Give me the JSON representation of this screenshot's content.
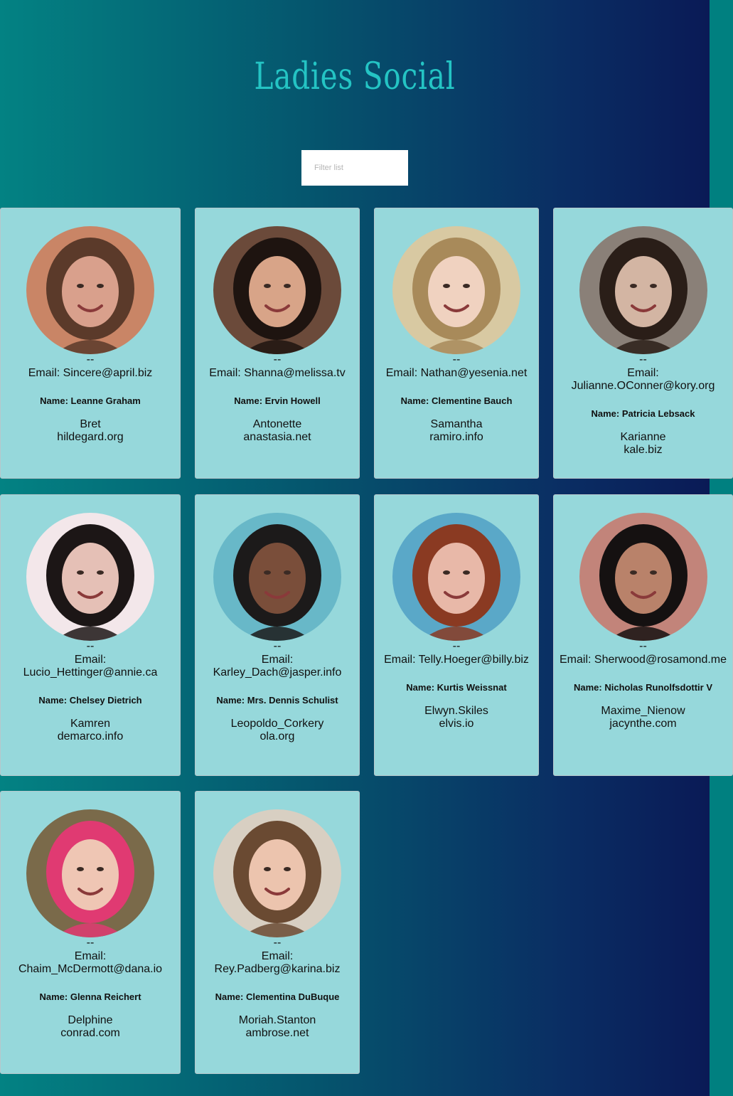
{
  "app": {
    "title": "Ladies Social"
  },
  "search": {
    "placeholder": "Filter list",
    "value": ""
  },
  "contacts": [
    {
      "dash": "--",
      "email_label": "Email:",
      "email": "Sincere@april.biz",
      "name_label": "Name:",
      "name": "Leanne Graham",
      "username": "Bret",
      "website": "hildegard.org",
      "photo_colors": [
        "#c98566",
        "#5b3a2a",
        "#d9a08c"
      ]
    },
    {
      "dash": "--",
      "email_label": "Email:",
      "email": "Shanna@melissa.tv",
      "name_label": "Name:",
      "name": "Ervin Howell",
      "username": "Antonette",
      "website": "anastasia.net",
      "photo_colors": [
        "#6b4a3a",
        "#1e1410",
        "#d8a488"
      ]
    },
    {
      "dash": "--",
      "email_label": "Email:",
      "email": "Nathan@yesenia.net",
      "name_label": "Name:",
      "name": "Clementine Bauch",
      "username": "Samantha",
      "website": "ramiro.info",
      "photo_colors": [
        "#d8c9a2",
        "#a88a5a",
        "#f0d2c0"
      ]
    },
    {
      "dash": "--",
      "email_label": "Email:",
      "email": "Julianne.OConner@kory.org",
      "name_label": "Name:",
      "name": "Patricia Lebsack",
      "username": "Karianne",
      "website": "kale.biz",
      "photo_colors": [
        "#8a8078",
        "#2a1e18",
        "#d3b5a3"
      ]
    },
    {
      "dash": "--",
      "email_label": "Email:",
      "email": "Lucio_Hettinger@annie.ca",
      "name_label": "Name:",
      "name": "Chelsey Dietrich",
      "username": "Kamren",
      "website": "demarco.info",
      "photo_colors": [
        "#f3e7ea",
        "#1c1616",
        "#e5c0b6"
      ]
    },
    {
      "dash": "--",
      "email_label": "Email:",
      "email": "Karley_Dach@jasper.info",
      "name_label": "Name:",
      "name": "Mrs. Dennis Schulist",
      "username": "Leopoldo_Corkery",
      "website": "ola.org",
      "photo_colors": [
        "#68b8c8",
        "#1c1a1a",
        "#7a4e3a"
      ]
    },
    {
      "dash": "--",
      "email_label": "Email:",
      "email": "Telly.Hoeger@billy.biz",
      "name_label": "Name:",
      "name": "Kurtis Weissnat",
      "username": "Elwyn.Skiles",
      "website": "elvis.io",
      "photo_colors": [
        "#5aa8c8",
        "#8a3a22",
        "#e8b8a8"
      ]
    },
    {
      "dash": "--",
      "email_label": "Email:",
      "email": "Sherwood@rosamond.me",
      "name_label": "Name:",
      "name": "Nicholas Runolfsdottir V",
      "username": "Maxime_Nienow",
      "website": "jacynthe.com",
      "photo_colors": [
        "#c2847a",
        "#151111",
        "#b9826a"
      ]
    },
    {
      "dash": "--",
      "email_label": "Email:",
      "email": "Chaim_McDermott@dana.io",
      "name_label": "Name:",
      "name": "Glenna Reichert",
      "username": "Delphine",
      "website": "conrad.com",
      "photo_colors": [
        "#7a6a4a",
        "#e03a72",
        "#efc6b4"
      ]
    },
    {
      "dash": "--",
      "email_label": "Email:",
      "email": "Rey.Padberg@karina.biz",
      "name_label": "Name:",
      "name": "Clementina DuBuque",
      "username": "Moriah.Stanton",
      "website": "ambrose.net",
      "photo_colors": [
        "#d8cfc2",
        "#6a4a32",
        "#ecc4ae"
      ]
    }
  ]
}
